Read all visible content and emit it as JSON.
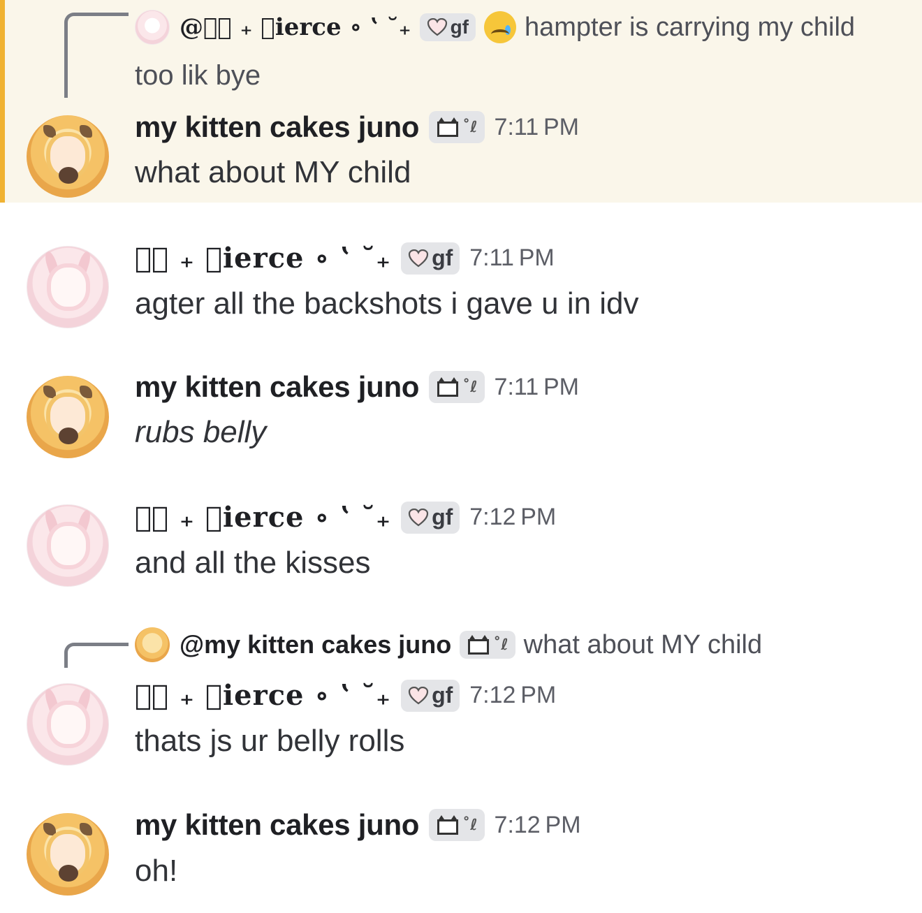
{
  "messages": [
    {
      "reply_to": {
        "author": "@ท͜ ₊ 𝓅ierce ∘ ʽ ˘₊",
        "tag": "gf",
        "text": "hampter is carrying my child"
      },
      "continued_text": "too lik bye",
      "author": "my kitten cakes juno",
      "tag_icon": "cat-pixel-icon",
      "time": "7:11 PM",
      "text": "what about MY child"
    },
    {
      "author": "ท͜ ₊ 𝓅ierce ∘ ʽ ˘₊",
      "tag": "gf",
      "time": "7:11 PM",
      "text": "agter all the backshots i gave u in idv"
    },
    {
      "author": "my kitten cakes juno",
      "time": "7:11 PM",
      "text": "rubs belly"
    },
    {
      "author": "ท͜ ₊ 𝓅ierce ∘ ʽ ˘₊",
      "tag": "gf",
      "time": "7:12 PM",
      "text": "and all the kisses"
    },
    {
      "reply_to": {
        "author": "@my kitten cakes juno",
        "text": "what about MY child"
      },
      "author": "ท͜ ₊ 𝓅ierce ∘ ʽ ˘₊",
      "tag": "gf",
      "time": "7:12 PM",
      "text": "thats js ur belly rolls"
    },
    {
      "author": "my kitten cakes juno",
      "time": "7:12 PM",
      "text": "oh!"
    }
  ],
  "colors": {
    "highlight_bg": "#faf6ea",
    "highlight_bar": "#f0b232",
    "tag_bg": "#e4e5e8"
  }
}
